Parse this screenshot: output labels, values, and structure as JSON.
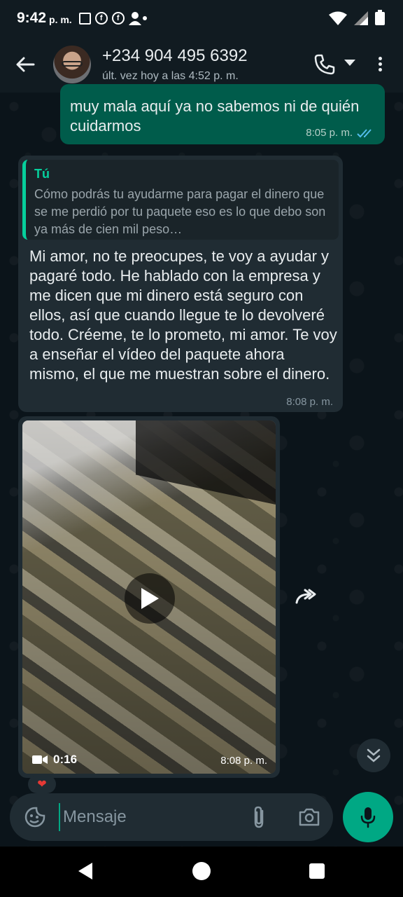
{
  "status_bar": {
    "time": "9:42",
    "ampm": "p. m."
  },
  "header": {
    "contact_name": "+234 904 495 6392",
    "last_seen": "últ. vez hoy a las 4:52 p. m."
  },
  "messages": {
    "outgoing": {
      "text": "muy mala aquí ya no sabemos ni de quién cuidarmos",
      "time": "8:05 p. m."
    },
    "reply": {
      "quote_author": "Tú",
      "quote_text": "Cómo podrás tu ayudarme para pagar el dinero que se me perdió por tu paquete eso es lo que debo son ya más de cien mil peso…",
      "text": "Mi amor, no te preocupes, te voy a ayudar y pagaré todo. He hablado con la empresa y me dicen que mi dinero está seguro con ellos, así que cuando llegue te lo devolveré todo. Créeme, te lo prometo, mi amor. Te voy a enseñar el vídeo del paquete ahora mismo, el que me muestran sobre el dinero.",
      "time": "8:08 p. m."
    },
    "video": {
      "duration": "0:16",
      "time": "8:08 p. m.",
      "reaction": "❤"
    }
  },
  "input": {
    "placeholder": "Mensaje"
  },
  "colors": {
    "accent": "#00a884",
    "outgoing_bubble": "#005c4b",
    "incoming_bubble": "#202c33",
    "background": "#0b141a"
  }
}
